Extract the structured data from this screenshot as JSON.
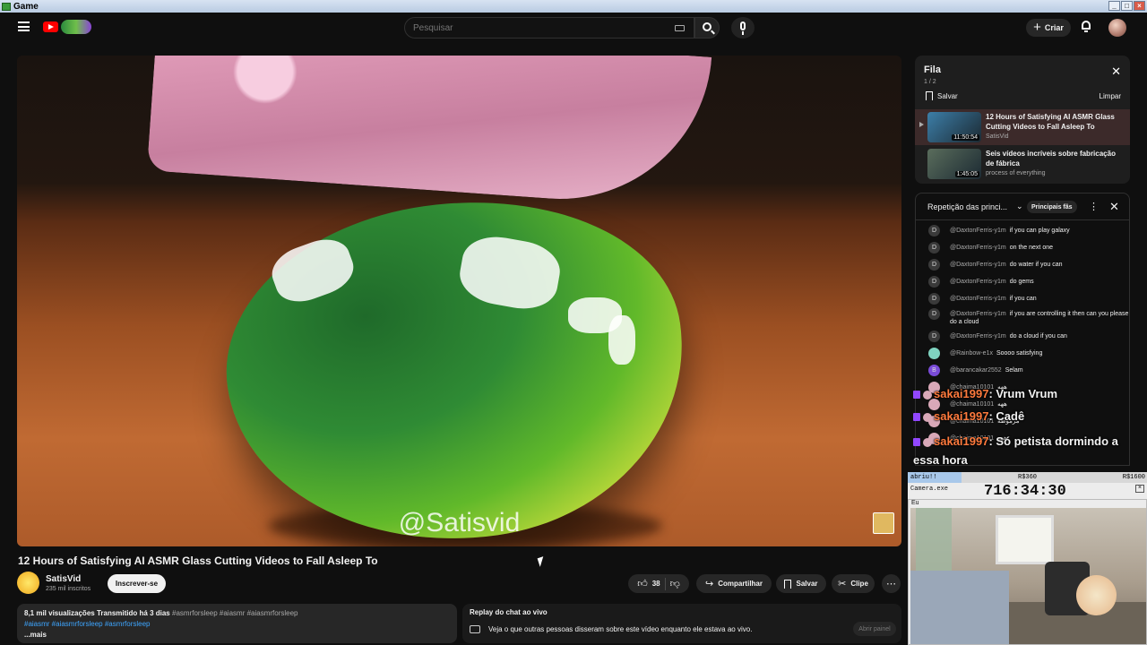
{
  "window": {
    "title": "Game"
  },
  "header": {
    "search_placeholder": "Pesquisar",
    "create_label": "Criar"
  },
  "video": {
    "watermark": "@Satisvid",
    "title": "12 Hours of Satisfying AI ASMR Glass Cutting Videos to Fall Asleep To",
    "channel": "SatisVid",
    "subscribers": "235 mil inscritos",
    "subscribe_label": "Inscrever-se",
    "likes": "38",
    "share_label": "Compartilhar",
    "save_label": "Salvar",
    "clip_label": "Clipe",
    "views": "8,1 mil visualizações",
    "streamed": "Transmitido há 3 dias",
    "tags_line1": "#asmrforsleep #aiasmr #aiasmrforsleep",
    "tags_line2": "#aiasmr #aiasmrforsleep #asmrforsleep",
    "more": "...mais"
  },
  "replay": {
    "title": "Replay do chat ao vivo",
    "desc": "Veja o que outras pessoas disseram sobre este vídeo enquanto ele estava ao vivo.",
    "open_label": "Abrir painel"
  },
  "queue": {
    "title": "Fila",
    "count": "1 / 2",
    "save_label": "Salvar",
    "clear_label": "Limpar",
    "items": [
      {
        "title": "12 Hours of Satisfying AI ASMR Glass Cutting Videos to Fall Asleep To",
        "channel": "SatisVid",
        "duration": "11:50:54",
        "thumb_color": "#3c7ea8"
      },
      {
        "title": "Seis vídeos incríveis sobre fabricação de fábrica",
        "channel": "process of everything",
        "duration": "1:45:05",
        "thumb_color": "#5a6d5c"
      }
    ]
  },
  "chat": {
    "header": "Repetição das princi...",
    "fans_label": "Principais fãs",
    "messages": [
      {
        "author": "@DaxtonFerris-y1m",
        "text": "if you can play galaxy",
        "initial": "D",
        "avatar_color": "#3a3a3a"
      },
      {
        "author": "@DaxtonFerris-y1m",
        "text": "on the next one",
        "initial": "D",
        "avatar_color": "#3a3a3a"
      },
      {
        "author": "@DaxtonFerris-y1m",
        "text": "do water if you can",
        "initial": "D",
        "avatar_color": "#3a3a3a"
      },
      {
        "author": "@DaxtonFerris-y1m",
        "text": "do gems",
        "initial": "D",
        "avatar_color": "#3a3a3a"
      },
      {
        "author": "@DaxtonFerris-y1m",
        "text": "if you can",
        "initial": "D",
        "avatar_color": "#3a3a3a"
      },
      {
        "author": "@DaxtonFerris-y1m",
        "text": "if you are controlling it then can you please do a cloud",
        "initial": "D",
        "avatar_color": "#3a3a3a"
      },
      {
        "author": "@DaxtonFerris-y1m",
        "text": "do a cloud if you can",
        "initial": "D",
        "avatar_color": "#3a3a3a"
      },
      {
        "author": "@Rainbow-e1x",
        "text": "Soooo satisfying",
        "initial": "",
        "avatar_color": "#7fd3c0"
      },
      {
        "author": "@barancakar2552",
        "text": "Selam",
        "initial": "B",
        "avatar_color": "#7a4bd8"
      },
      {
        "author": "@chaima10101",
        "text": "ههه",
        "initial": "",
        "avatar_color": "#d9a8b8"
      },
      {
        "author": "@chaima10101",
        "text": "ههه",
        "initial": "",
        "avatar_color": "#d9a8b8"
      },
      {
        "author": "@chaima10101",
        "text": "مرموظة",
        "initial": "",
        "avatar_color": "#d9a8b8"
      },
      {
        "author": "@chaima10101",
        "text": "ههه",
        "initial": "",
        "avatar_color": "#d9a8b8"
      }
    ]
  },
  "overlay_chat": [
    {
      "user": "sakai1997",
      "text": ": Vrum Vrum"
    },
    {
      "user": "sakai1997",
      "text": ": Cadê"
    },
    {
      "user": "sakai1997",
      "text": ": Só petista dormindo a essa hora"
    }
  ],
  "stream": {
    "donation_label": "abriu!!",
    "goal_current": "R$360",
    "goal_target": "R$1600",
    "goal_fraction": 0.225,
    "camera_label": "Camera.exe",
    "camera_sublabel": "Eu",
    "timer": "716:34:30"
  }
}
